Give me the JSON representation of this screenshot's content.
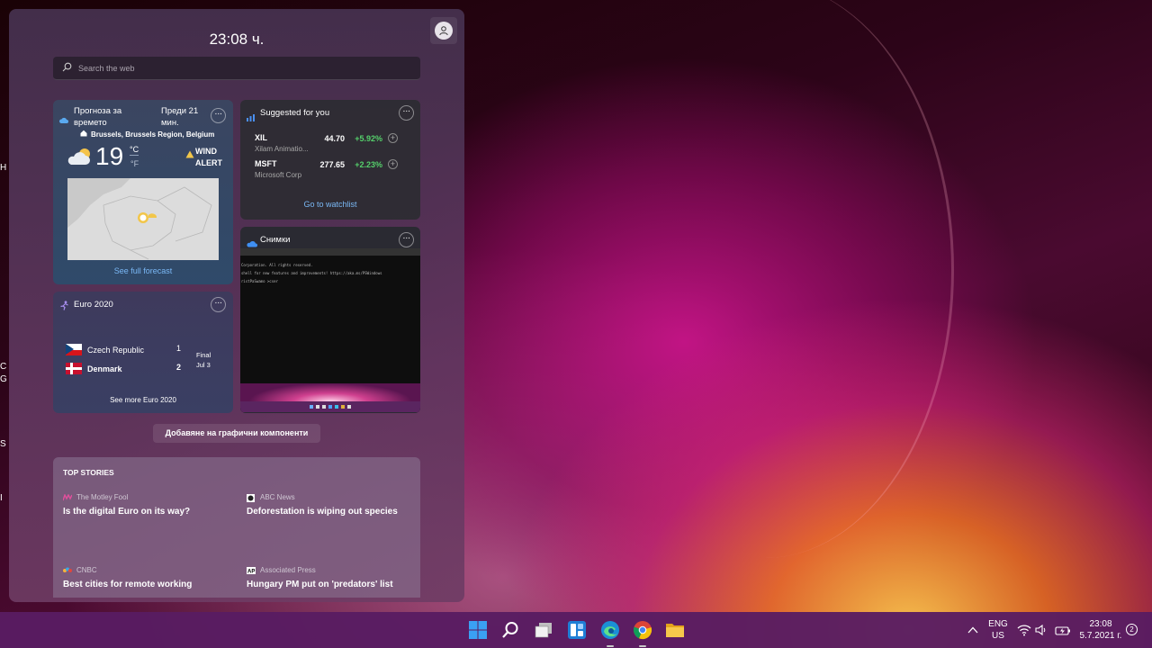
{
  "widgets": {
    "clock": "23:08 ч.",
    "search_placeholder": "Search the web",
    "weather": {
      "title": "Прогноза за времето",
      "updated": "Преди 21 мин.",
      "location": "Brussels, Brussels Region, Belgium",
      "temperature": "19",
      "unit_c": "°C",
      "unit_f": "°F",
      "alert": "WIND ALERT",
      "link": "See full forecast"
    },
    "stocks": {
      "title": "Suggested for you",
      "items": [
        {
          "symbol": "XIL",
          "name": "Xilam Animatio...",
          "price": "44.70",
          "change": "+5.92%"
        },
        {
          "symbol": "MSFT",
          "name": "Microsoft Corp",
          "price": "277.65",
          "change": "+2.23%"
        }
      ],
      "link": "Go to watchlist"
    },
    "photos": {
      "title": "Снимки",
      "terminal_lines": [
        "Corporation. All rights reserved.",
        "shell for new features and improvements! https://aka.ms/PSWindows",
        "ristPaSwamo >cser"
      ]
    },
    "euro": {
      "title": "Euro 2020",
      "team1": "Czech Republic",
      "score1": "1",
      "team2": "Denmark",
      "score2": "2",
      "status": "Final",
      "date": "Jul 3",
      "link": "See more Euro 2020"
    },
    "add_widgets": "Добавяне на графични компоненти",
    "top_stories": {
      "heading": "TOP STORIES",
      "items": [
        {
          "source": "The Motley Fool",
          "headline": "Is the digital Euro on its way?"
        },
        {
          "source": "ABC News",
          "headline": "Deforestation is wiping out species"
        },
        {
          "source": "CNBC",
          "headline": "Best cities for remote working"
        },
        {
          "source": "Associated Press",
          "headline": "Hungary PM put on 'predators' list"
        }
      ]
    }
  },
  "taskbar": {
    "lang_top": "ENG",
    "lang_bottom": "US",
    "time": "23:08",
    "date": "5.7.2021 г.",
    "notifications": "2",
    "apps": [
      "start-icon",
      "search-icon",
      "task-view-icon",
      "widgets-icon",
      "edge-icon",
      "chrome-icon",
      "file-explorer-icon"
    ]
  },
  "desktop_fragments": [
    "Н",
    "С",
    "G",
    "S",
    "I"
  ],
  "colors": {
    "accent": "#7ab8f5",
    "positive": "#55d06b",
    "taskbar": "#581c62"
  }
}
